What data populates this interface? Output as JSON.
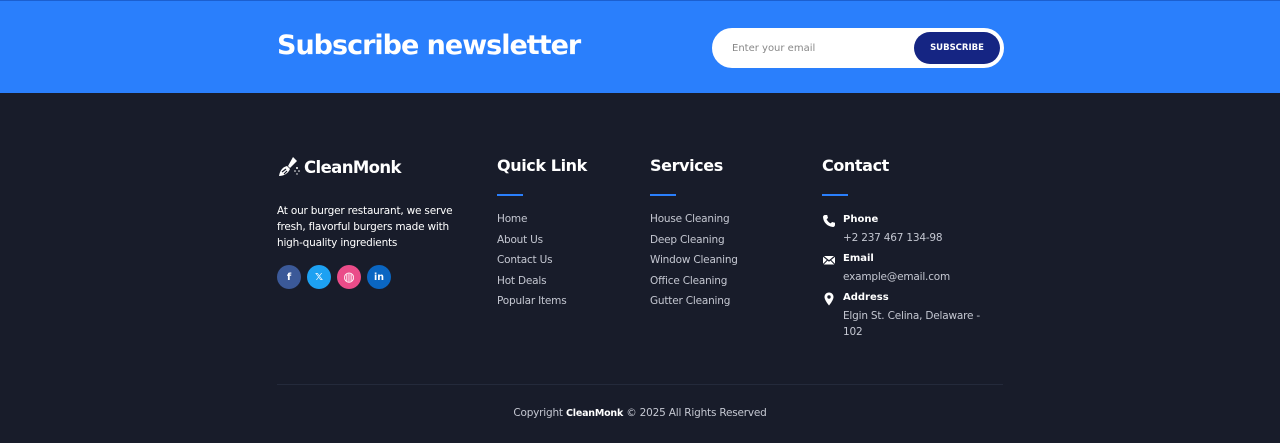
{
  "newsletter": {
    "title": "Subscribe newsletter",
    "email_placeholder": "Enter your email",
    "subscribe_label": "SUBSCRIBE",
    "background": "#2a7ffc",
    "button_color": "#152583"
  },
  "brand": {
    "name": "CleanMonk",
    "logo_icon": "broom-spray-icon",
    "description": "At our burger restaurant, we serve fresh, flavorful burgers made with high-quality ingredients"
  },
  "social": [
    {
      "name": "facebook",
      "glyph": "f",
      "color": "#3b5998"
    },
    {
      "name": "x",
      "glyph": "𝕏",
      "color": "#1da1f2"
    },
    {
      "name": "dribbble",
      "glyph": "◍",
      "color": "#ea4c89"
    },
    {
      "name": "linkedin",
      "glyph": "in",
      "color": "#0a66c2"
    }
  ],
  "quick_link": {
    "title": "Quick Link",
    "items": [
      "Home",
      "About Us",
      "Contact Us",
      "Hot Deals",
      "Popular Items"
    ]
  },
  "services": {
    "title": "Services",
    "items": [
      "House Cleaning",
      "Deep Cleaning",
      "Window Cleaning",
      "Office Cleaning",
      "Gutter Cleaning"
    ]
  },
  "contact": {
    "title": "Contact",
    "phone": {
      "label": "Phone",
      "value": "+2 237 467 134-98",
      "icon": "phone-icon"
    },
    "email": {
      "label": "Email",
      "value": "example@email.com",
      "icon": "envelope-icon"
    },
    "address": {
      "label": "Address",
      "value": "Elgin St. Celina, Delaware - 102",
      "icon": "map-pin-icon"
    }
  },
  "copyright": {
    "prefix": "Copyright ",
    "brand": "CleanMonk",
    "suffix": " © 2025 All Rights Reserved"
  },
  "colors": {
    "footer_bg": "#181c2a",
    "accent": "#2a7ffc",
    "muted_text": "#c4c7d1"
  }
}
